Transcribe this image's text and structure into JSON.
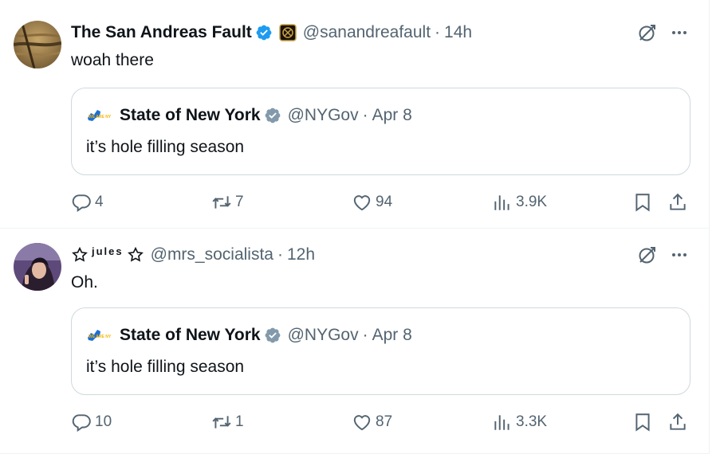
{
  "tweets": [
    {
      "display_name": "The San Andreas Fault",
      "handle": "@sanandreafault",
      "separator": "·",
      "time": "14h",
      "text": "woah there",
      "quote": {
        "display_name": "State of New York",
        "handle": "@NYGov",
        "separator": "·",
        "time": "Apr 8",
        "text": "it’s hole filling season",
        "logo_text": "WE ARE NY"
      },
      "counts": {
        "replies": "4",
        "reposts": "7",
        "likes": "94",
        "views": "3.9K"
      }
    },
    {
      "display_name": "jules",
      "handle": "@mrs_socialista",
      "separator": "·",
      "time": "12h",
      "text": "Oh.",
      "quote": {
        "display_name": "State of New York",
        "handle": "@NYGov",
        "separator": "·",
        "time": "Apr 8",
        "text": "it’s hole filling season",
        "logo_text": "WE ARE NY"
      },
      "counts": {
        "replies": "10",
        "reposts": "1",
        "likes": "87",
        "views": "3.3K"
      }
    }
  ],
  "icons": {
    "verified": "verified-badge-icon",
    "verified_gray": "verified-gray-badge-icon",
    "reply": "reply-icon",
    "repost": "repost-icon",
    "like": "heart-icon",
    "views": "views-icon",
    "bookmark": "bookmark-icon",
    "share": "share-icon",
    "grok": "grok-icon",
    "more": "more-icon"
  },
  "colors": {
    "text": "#0f1419",
    "secondary": "#536471",
    "verified_blue": "#1d9bf0",
    "verified_gray": "#829aab",
    "border": "#cfd9de"
  }
}
